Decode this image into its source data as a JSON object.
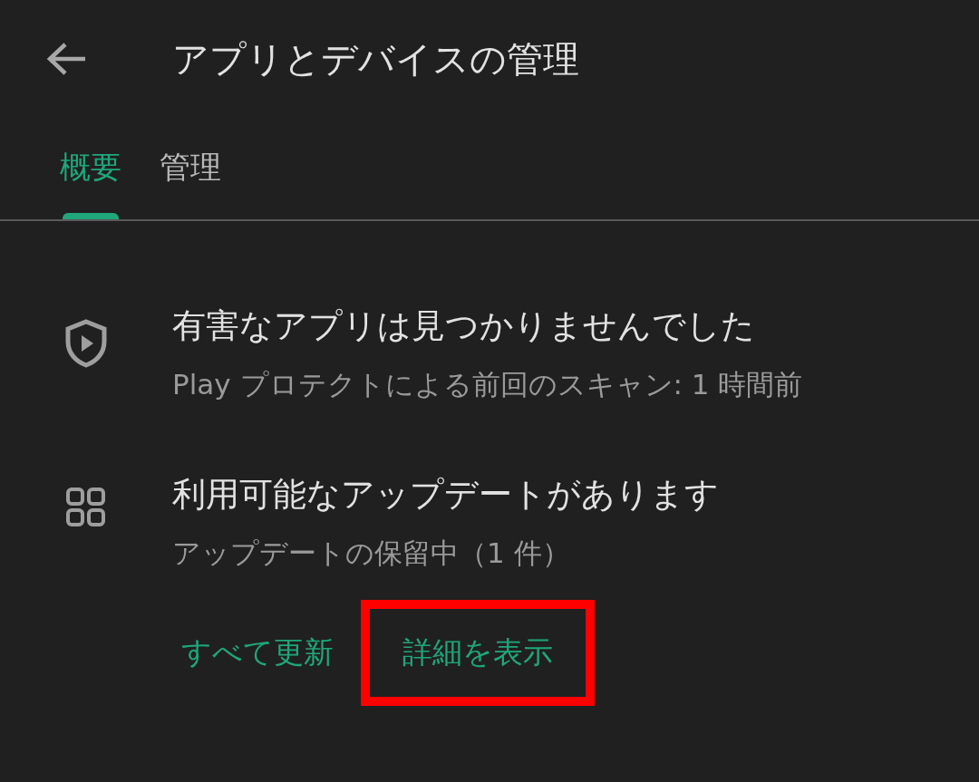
{
  "header": {
    "title": "アプリとデバイスの管理"
  },
  "tabs": [
    {
      "label": "概要",
      "selected": true
    },
    {
      "label": "管理",
      "selected": false
    }
  ],
  "sections": [
    {
      "kind": "protect",
      "title": "有害なアプリは見つかりませんでした",
      "subtitle": "Play プロテクトによる前回のスキャン: 1 時間前"
    },
    {
      "kind": "updates",
      "title": "利用可能なアップデートがあります",
      "subtitle": "アップデートの保留中（1 件）",
      "actions": [
        {
          "label": "すべて更新",
          "highlighted": false
        },
        {
          "label": "詳細を表示",
          "highlighted": true
        }
      ]
    }
  ]
}
